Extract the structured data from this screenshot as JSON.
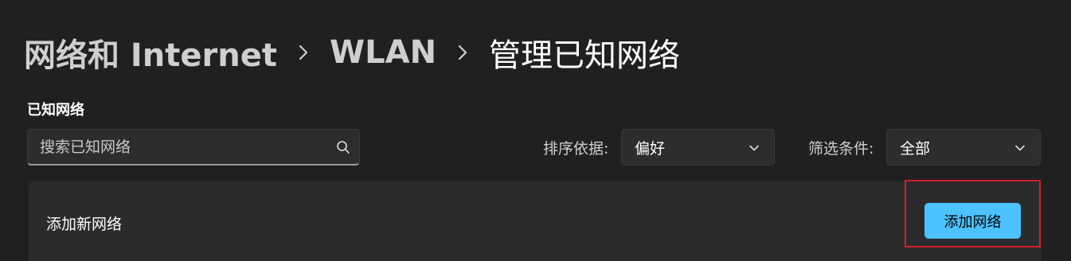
{
  "breadcrumb": {
    "items": [
      "网络和 Internet",
      "WLAN"
    ],
    "current": "管理已知网络"
  },
  "known_networks": {
    "section_title": "已知网络",
    "search": {
      "placeholder": "搜索已知网络",
      "value": "",
      "icon": "search-icon"
    },
    "sort": {
      "label": "排序依据:",
      "value": "偏好",
      "icon": "chevron-down-icon"
    },
    "filter": {
      "label": "筛选条件:",
      "value": "全部",
      "icon": "chevron-down-icon"
    },
    "add_network": {
      "label": "添加新网络",
      "button_label": "添加网络"
    }
  },
  "colors": {
    "background": "#202020",
    "card": "#2b2b2b",
    "accent": "#4cc2ff",
    "highlight": "#d4202a"
  }
}
